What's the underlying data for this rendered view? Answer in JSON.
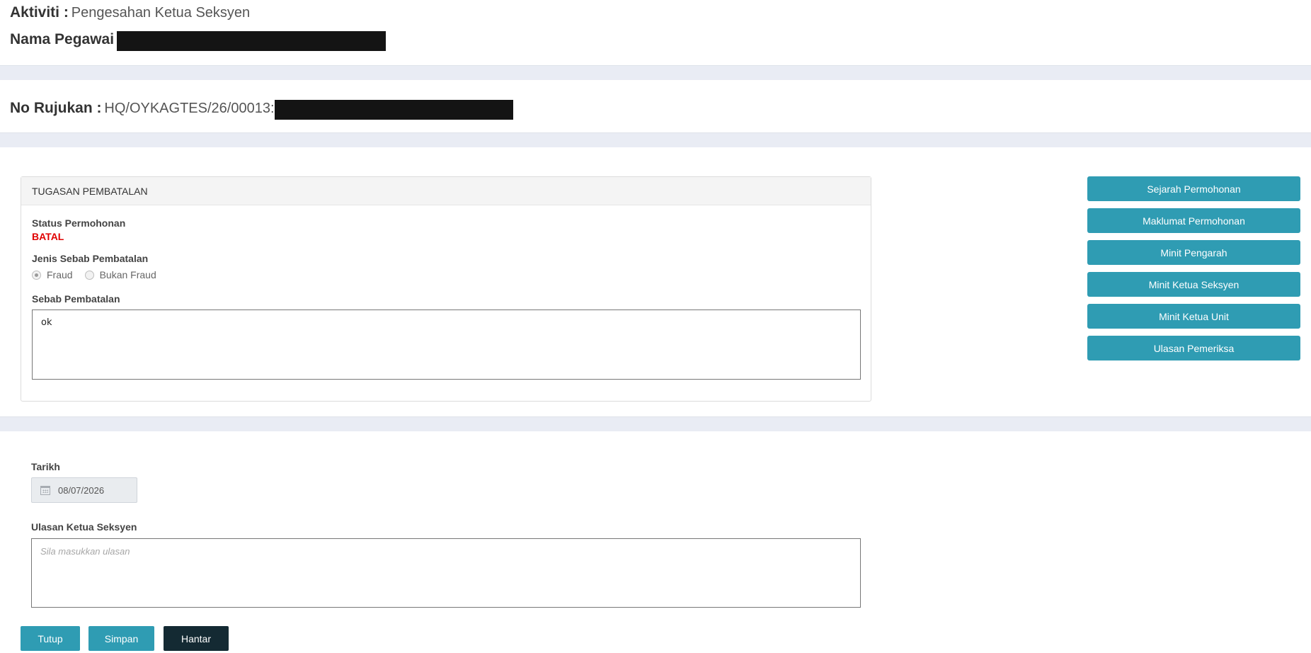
{
  "header": {
    "aktiviti_label": "Aktiviti :",
    "aktiviti_value": "Pengesahan Ketua Seksyen",
    "nama_label": "Nama Pegawai",
    "rujukan_label": "No Rujukan :",
    "rujukan_value": "HQ/OYKAGTES/26/00013:"
  },
  "panel": {
    "title": "TUGASAN PEMBATALAN",
    "status_label": "Status Permohonan",
    "status_value": "BATAL",
    "jenis_label": "Jenis Sebab Pembatalan",
    "radio_options": [
      "Fraud",
      "Bukan Fraud"
    ],
    "radio_selected": "Fraud",
    "sebab_label": "Sebab Pembatalan",
    "sebab_value": "ok"
  },
  "side_buttons": [
    "Sejarah Permohonan",
    "Maklumat Permohonan",
    "Minit Pengarah",
    "Minit Ketua Seksyen",
    "Minit Ketua Unit",
    "Ulasan Pemeriksa"
  ],
  "form": {
    "tarikh_label": "Tarikh",
    "tarikh_value": "08/07/2026",
    "ulasan_label": "Ulasan Ketua Seksyen",
    "ulasan_placeholder": "Sila masukkan ulasan"
  },
  "actions": {
    "tutup": "Tutup",
    "simpan": "Simpan",
    "hantar": "Hantar"
  },
  "colors": {
    "primary_button": "#2f9cb3",
    "dark_button": "#142a33",
    "status_red": "#e00000",
    "band": "#e9ecf4"
  }
}
